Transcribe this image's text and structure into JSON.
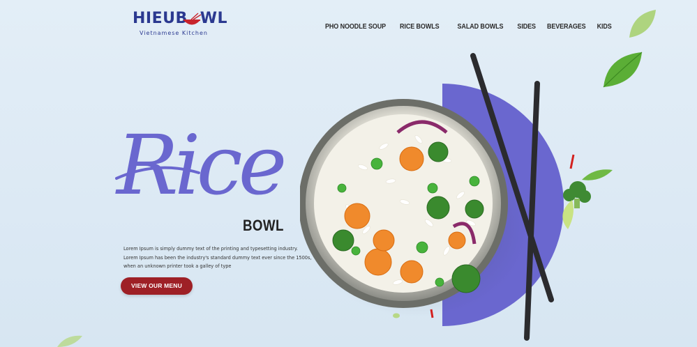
{
  "brand": {
    "name_part1": "HIEUB",
    "name_part2": "WL",
    "tagline": "Vietnamese Kitchen"
  },
  "nav": {
    "items": [
      {
        "label": "PHO NOODLE SOUP"
      },
      {
        "label": "RICE BOWLS"
      },
      {
        "label": "SALAD BOWLS"
      },
      {
        "label": "SIDES"
      },
      {
        "label": "BEVERAGES"
      },
      {
        "label": "KIDS"
      }
    ]
  },
  "hero": {
    "script_title": "Rice",
    "subtitle": "BOWL",
    "description": "Lorem Ipsum is simply dummy text of the printing and typesetting industry. Lorem Ipsum has been the industry's standard dummy text ever since the 1500s, when an unknown printer took a galley of type",
    "cta_label": "VIEW OUR MENU"
  },
  "colors": {
    "brand_blue": "#2b3990",
    "brand_red": "#c8242c",
    "accent_purple": "#6a67cf",
    "cta_red": "#9e2026",
    "background": "#e3eef7"
  },
  "icons": {
    "logo_mark": "bowl-with-chopsticks-icon"
  }
}
